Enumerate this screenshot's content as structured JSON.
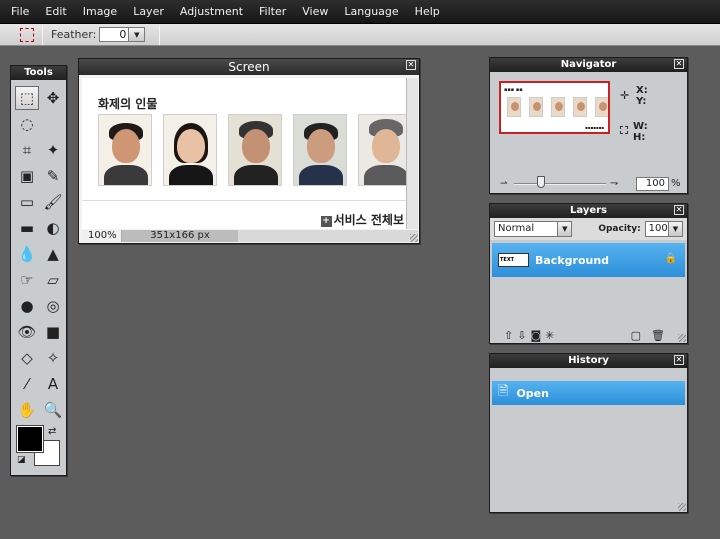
{
  "menu": [
    "File",
    "Edit",
    "Image",
    "Layer",
    "Adjustment",
    "Filter",
    "View",
    "Language",
    "Help"
  ],
  "options": {
    "feather_label": "Feather:",
    "feather_value": "0"
  },
  "tools_panel": {
    "title": "Tools",
    "tools": [
      {
        "name": "marquee-select-tool",
        "glyph": "⬚"
      },
      {
        "name": "move-tool",
        "glyph": "✥"
      },
      {
        "name": "lasso-tool",
        "glyph": "◌"
      },
      {
        "name": "blank",
        "glyph": ""
      },
      {
        "name": "crop-tool",
        "glyph": "⌗"
      },
      {
        "name": "magic-wand-tool",
        "glyph": "✦"
      },
      {
        "name": "stamp-tool",
        "glyph": "▣"
      },
      {
        "name": "pencil-tool",
        "glyph": "✎"
      },
      {
        "name": "eraser-tool",
        "glyph": "▭"
      },
      {
        "name": "brush-tool",
        "glyph": "🖌"
      },
      {
        "name": "rect-shape-tool",
        "glyph": "▬"
      },
      {
        "name": "replace-color-tool",
        "glyph": "◐"
      },
      {
        "name": "drop-tool",
        "glyph": "💧"
      },
      {
        "name": "sharpen-tool",
        "glyph": "▲"
      },
      {
        "name": "smudge-tool",
        "glyph": "☞"
      },
      {
        "name": "sponge-tool",
        "glyph": "▱"
      },
      {
        "name": "burn-tool",
        "glyph": "●"
      },
      {
        "name": "red-eye-tool",
        "glyph": "◎"
      },
      {
        "name": "eye-tool",
        "glyph": "👁"
      },
      {
        "name": "rectangle-tool",
        "glyph": "■"
      },
      {
        "name": "bloat-tool",
        "glyph": "◇"
      },
      {
        "name": "pinch-tool",
        "glyph": "✧"
      },
      {
        "name": "eyedropper-tool",
        "glyph": "⁄"
      },
      {
        "name": "text-tool",
        "glyph": "A"
      },
      {
        "name": "hand-tool",
        "glyph": "✋"
      },
      {
        "name": "zoom-tool",
        "glyph": "🔍"
      }
    ],
    "fg_color": "#000000",
    "bg_color": "#ffffff"
  },
  "screen_window": {
    "title": "Screen",
    "heading": "화제의 인물",
    "more_link": "서비스 전체보",
    "zoom": "100%",
    "dimensions": "351x166 px"
  },
  "navigator": {
    "title": "Navigator",
    "x_label": "X:",
    "y_label": "Y:",
    "w_label": "W:",
    "h_label": "H:",
    "zoom_value": "100",
    "percent": "%"
  },
  "layers_panel": {
    "title": "Layers",
    "blend_mode": "Normal",
    "opacity_label": "Opacity:",
    "opacity_value": "100",
    "layer_name": "Background",
    "layer_thumb_text": "TEXT"
  },
  "history_panel": {
    "title": "History",
    "item": "Open"
  },
  "colors": {
    "selection_blue": "#3fa2e6",
    "title_bar": "#2a2a2a",
    "workspace": "#5c5c5c"
  }
}
